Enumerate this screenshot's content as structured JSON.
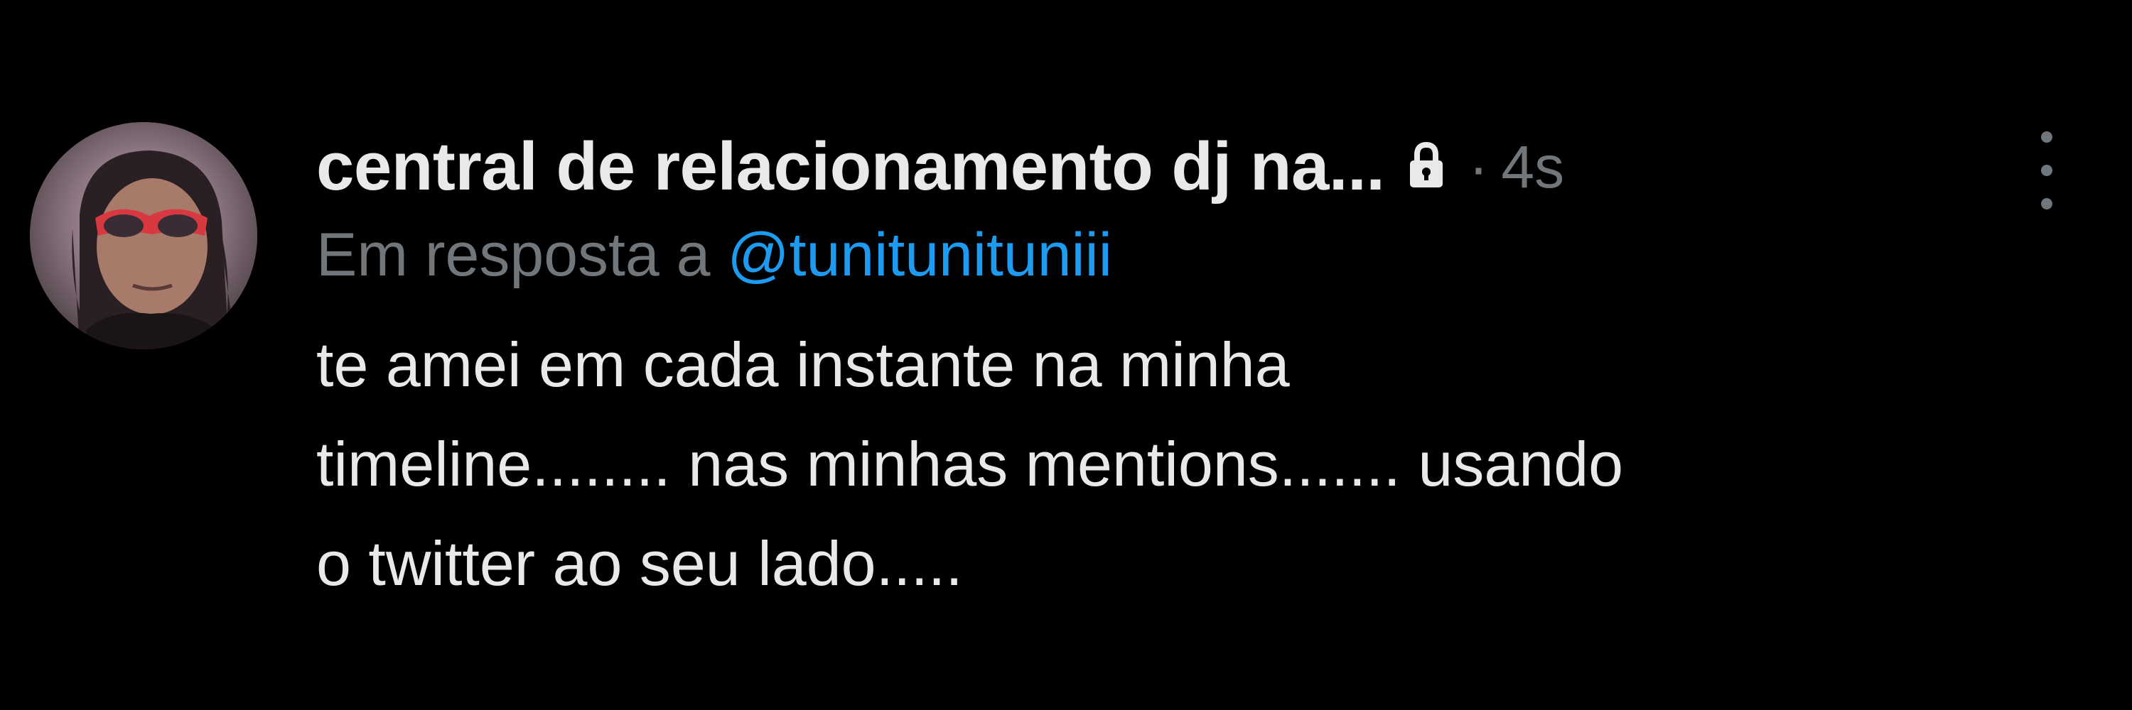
{
  "tweet": {
    "display_name": "central de relacionamento dj na...",
    "lock_icon": "lock-icon",
    "separator": "·",
    "timestamp": "4s",
    "more_icon": "more-vertical-icon",
    "reply_prefix": "Em resposta a",
    "reply_handle": "@tunitunituniii",
    "text_lines": [
      "te amei em cada instante na minha",
      "timeline........ nas minhas mentions....... usando",
      "o twitter ao seu lado....."
    ]
  },
  "colors": {
    "background": "#000000",
    "primary_text": "#e7e9ea",
    "secondary_text": "#71767b",
    "link": "#1d9bf0"
  }
}
